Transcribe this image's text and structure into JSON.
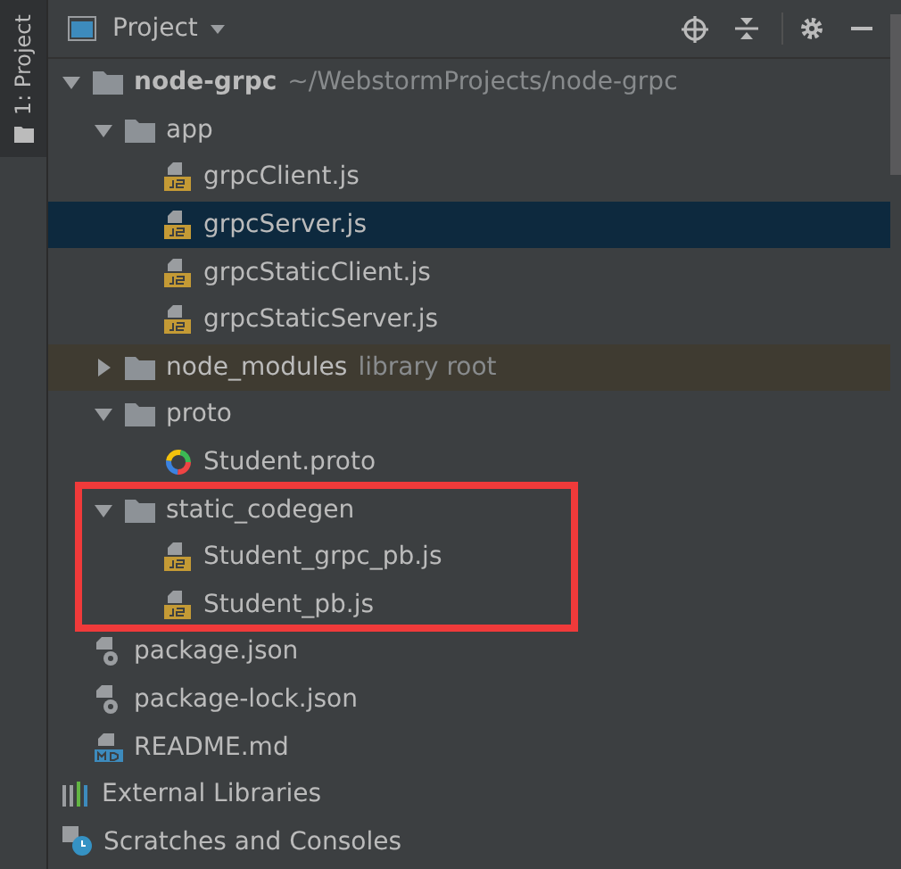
{
  "side_tab": {
    "label": "1: Project",
    "selected": true
  },
  "header": {
    "title": "Project"
  },
  "tree": [
    {
      "kind": "project",
      "name": "node-grpc",
      "path": "~/WebstormProjects/node-grpc",
      "expanded": true,
      "selected": false,
      "children": [
        {
          "kind": "folder",
          "name": "app",
          "expanded": true,
          "selected": false,
          "children": [
            {
              "kind": "js",
              "name": "grpcClient.js",
              "selected": false
            },
            {
              "kind": "js",
              "name": "grpcServer.js",
              "selected": true
            },
            {
              "kind": "js",
              "name": "grpcStaticClient.js",
              "selected": false
            },
            {
              "kind": "js",
              "name": "grpcStaticServer.js",
              "selected": false
            }
          ]
        },
        {
          "kind": "library",
          "name": "node_modules",
          "suffix": "library root",
          "expanded": false,
          "selected": false
        },
        {
          "kind": "folder",
          "name": "proto",
          "expanded": true,
          "selected": false,
          "children": [
            {
              "kind": "proto",
              "name": "Student.proto",
              "selected": false
            }
          ]
        },
        {
          "kind": "folder",
          "name": "static_codegen",
          "expanded": true,
          "selected": false,
          "highlighted": true,
          "children": [
            {
              "kind": "js",
              "name": "Student_grpc_pb.js",
              "selected": false
            },
            {
              "kind": "js",
              "name": "Student_pb.js",
              "selected": false
            }
          ]
        },
        {
          "kind": "json",
          "name": "package.json",
          "selected": false
        },
        {
          "kind": "json",
          "name": "package-lock.json",
          "selected": false
        },
        {
          "kind": "md",
          "name": "README.md",
          "selected": false
        }
      ]
    },
    {
      "kind": "libraries",
      "name": "External Libraries",
      "selected": false
    },
    {
      "kind": "scratches",
      "name": "Scratches and Consoles",
      "selected": false
    }
  ]
}
